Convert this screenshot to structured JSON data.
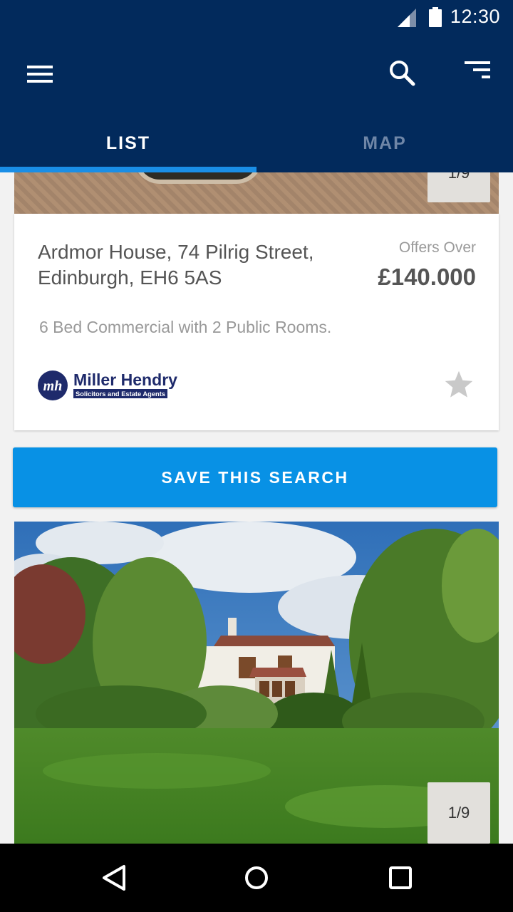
{
  "status_bar": {
    "time": "12:30",
    "icons": [
      "signal-icon",
      "battery-icon"
    ]
  },
  "app_bar": {
    "icons": [
      "menu-icon",
      "search-icon",
      "filter-sort-icon"
    ]
  },
  "tabs": [
    {
      "label": "LIST",
      "selected": true
    },
    {
      "label": "MAP",
      "selected": false
    }
  ],
  "listings": [
    {
      "image_counter": "1/9",
      "address": "Ardmor House, 74 Pilrig Street, Edinburgh, EH6 5AS",
      "price_qualifier": "Offers Over",
      "price": "£140.000",
      "description": "6 Bed Commercial with 2 Public Rooms.",
      "agent": {
        "logo_monogram": "mh",
        "logo_name": "Miller Hendry",
        "logo_tagline": "Solicitors and Estate Agents"
      },
      "favourite": false
    },
    {
      "image_counter": "1/9"
    }
  ],
  "save_search": {
    "label": "SAVE THIS SEARCH"
  },
  "colors": {
    "primary": "#022a5c",
    "accent": "#0891e5",
    "tab_indicator": "#1a8ee6"
  },
  "nav_bar": {
    "icons": [
      "back-icon",
      "home-icon",
      "recents-icon"
    ]
  }
}
